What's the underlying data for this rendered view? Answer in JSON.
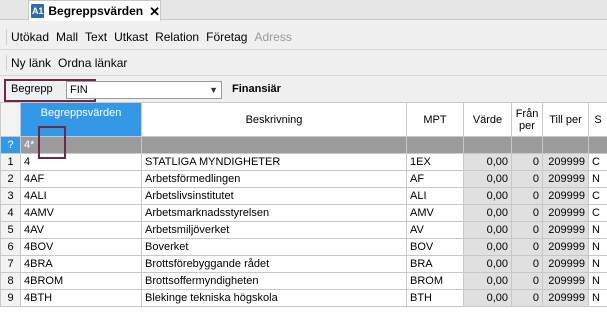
{
  "tab": {
    "icon_text": "A1",
    "title": "Begreppsvärden",
    "close": "✕"
  },
  "toolbar1": [
    {
      "label": "Utökad",
      "enabled": true
    },
    {
      "label": "Mall",
      "enabled": true
    },
    {
      "label": "Text",
      "enabled": true
    },
    {
      "label": "Utkast",
      "enabled": true
    },
    {
      "label": "Relation",
      "enabled": true
    },
    {
      "label": "Företag",
      "enabled": true
    },
    {
      "label": "Adress",
      "enabled": false
    }
  ],
  "toolbar2": [
    {
      "label": "Ny länk",
      "enabled": true
    },
    {
      "label": "Ordna länkar",
      "enabled": true
    }
  ],
  "filter": {
    "label": "Begrepp",
    "value": "FIN",
    "description": "Finansiär"
  },
  "columns": {
    "idx": "",
    "key": "Begreppsvärden",
    "desc": "Beskrivning",
    "mpt": "MPT",
    "varde": "Värde",
    "fran": "Från per",
    "till": "Till per",
    "s": "S"
  },
  "new_row": {
    "idx": "?",
    "key": "4*"
  },
  "rows": [
    {
      "idx": "1",
      "key": "4",
      "desc": "STATLIGA MYNDIGHETER",
      "mpt": "1EX",
      "varde": "0,00",
      "fran": "0",
      "till": "209999",
      "s": "C"
    },
    {
      "idx": "2",
      "key": "4AF",
      "desc": "Arbetsförmedlingen",
      "mpt": "AF",
      "varde": "0,00",
      "fran": "0",
      "till": "209999",
      "s": "N"
    },
    {
      "idx": "3",
      "key": "4ALI",
      "desc": "Arbetslivsinstitutet",
      "mpt": "ALI",
      "varde": "0,00",
      "fran": "0",
      "till": "209999",
      "s": "C"
    },
    {
      "idx": "4",
      "key": "4AMV",
      "desc": "Arbetsmarknadsstyrelsen",
      "mpt": "AMV",
      "varde": "0,00",
      "fran": "0",
      "till": "209999",
      "s": "C"
    },
    {
      "idx": "5",
      "key": "4AV",
      "desc": "Arbetsmiljöverket",
      "mpt": "AV",
      "varde": "0,00",
      "fran": "0",
      "till": "209999",
      "s": "N"
    },
    {
      "idx": "6",
      "key": "4BOV",
      "desc": "Boverket",
      "mpt": "BOV",
      "varde": "0,00",
      "fran": "0",
      "till": "209999",
      "s": "N"
    },
    {
      "idx": "7",
      "key": "4BRA",
      "desc": "Brottsförebyggande rådet",
      "mpt": "BRA",
      "varde": "0,00",
      "fran": "0",
      "till": "209999",
      "s": "N"
    },
    {
      "idx": "8",
      "key": "4BROM",
      "desc": "Brottsoffermyndigheten",
      "mpt": "BROM",
      "varde": "0,00",
      "fran": "0",
      "till": "209999",
      "s": "N"
    },
    {
      "idx": "9",
      "key": "4BTH",
      "desc": "Blekinge tekniska högskola",
      "mpt": "BTH",
      "varde": "0,00",
      "fran": "0",
      "till": "209999",
      "s": "N"
    }
  ],
  "colors": {
    "accent": "#3399e6",
    "highlight_border": "#6b2a4a",
    "new_row_bg": "#9b9b9b"
  }
}
